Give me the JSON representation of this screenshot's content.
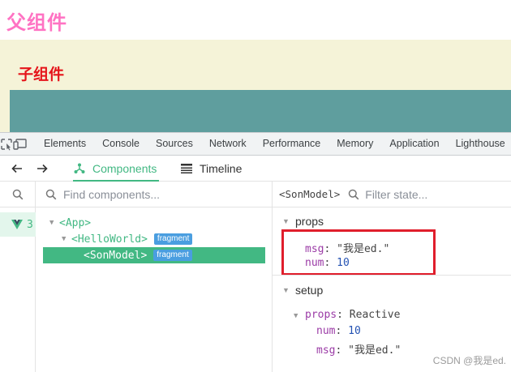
{
  "page": {
    "parent_title": "父组件",
    "child_title": "子组件"
  },
  "devtools": {
    "tabs": [
      "Elements",
      "Console",
      "Sources",
      "Network",
      "Performance",
      "Memory",
      "Application",
      "Lighthouse"
    ]
  },
  "vue_devtools": {
    "tabs": [
      {
        "label": "Components",
        "icon": "components-icon",
        "active": true
      },
      {
        "label": "Timeline",
        "icon": "timeline-icon",
        "active": false
      }
    ],
    "app_count": "3",
    "search_placeholder": "Find components...",
    "tree": [
      {
        "label": "<App>",
        "badge": ""
      },
      {
        "label": "<HelloWorld>",
        "badge": "fragment"
      },
      {
        "label": "<SonModel>",
        "badge": "fragment",
        "selected": true
      }
    ],
    "inspector": {
      "component": "<SonModel>",
      "filter_placeholder": "Filter state...",
      "props_title": "props",
      "props": [
        {
          "key": "msg",
          "value": "\"我是ed.\""
        },
        {
          "key": "num",
          "value": "10"
        }
      ],
      "setup_title": "setup",
      "setup_group_key": "props",
      "setup_group_value": "Reactive",
      "setup_items": [
        {
          "key": "num",
          "value": "10"
        },
        {
          "key": "msg",
          "value": "\"我是ed.\""
        }
      ]
    }
  },
  "watermark": "CSDN @我是ed.",
  "colors": {
    "vue_green": "#42b883",
    "highlight_red": "#e01e2c",
    "parent_pink": "#ff73c3",
    "child_red": "#e5141a",
    "teal": "#5f9e9e"
  }
}
